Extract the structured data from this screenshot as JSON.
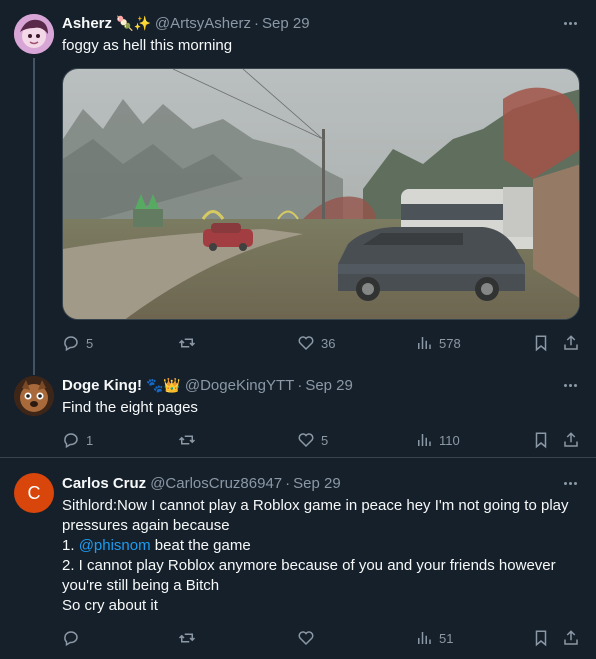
{
  "tweets": [
    {
      "name": "Asherz",
      "name_emoji": "🍡✨",
      "handle": "@ArtsyAsherz",
      "time": "Sep 29",
      "text": "foggy as hell this morning",
      "media": "foggy morning photo: campground with dark SUV, red car, RV trailer, autumn trees",
      "replies": "5",
      "retweets": "",
      "likes": "36",
      "views": "578"
    },
    {
      "name": "Doge King!",
      "name_emoji": "🐾👑",
      "handle": "@DogeKingYTT",
      "time": "Sep 29",
      "text": "Find the eight pages",
      "replies": "1",
      "retweets": "",
      "likes": "5",
      "views": "110"
    },
    {
      "name": "Carlos Cruz",
      "avatar_letter": "C",
      "handle": "@CarlosCruz86947",
      "time": "Sep 29",
      "text_lines": [
        "Sithlord:Now I cannot play a Roblox game in peace hey I'm not going to play",
        "pressures again because",
        "1. ",
        "2. I cannot play Roblox anymore because of you and your friends however",
        "you're still being a Bitch",
        "So cry about it"
      ],
      "mention": "@phisnom",
      "mention_tail": " beat the game",
      "replies": "",
      "retweets": "",
      "likes": "",
      "views": "51"
    }
  ],
  "colors": {
    "background": "#15202b",
    "text_primary": "#f7f9f9",
    "text_secondary": "#8b98a5",
    "link": "#1d9bf0",
    "divider": "#38444d",
    "avatar_c": "#d9460b"
  },
  "icons": [
    "reply-icon",
    "retweet-icon",
    "like-icon",
    "views-icon",
    "bookmark-icon",
    "share-icon",
    "more-icon"
  ]
}
